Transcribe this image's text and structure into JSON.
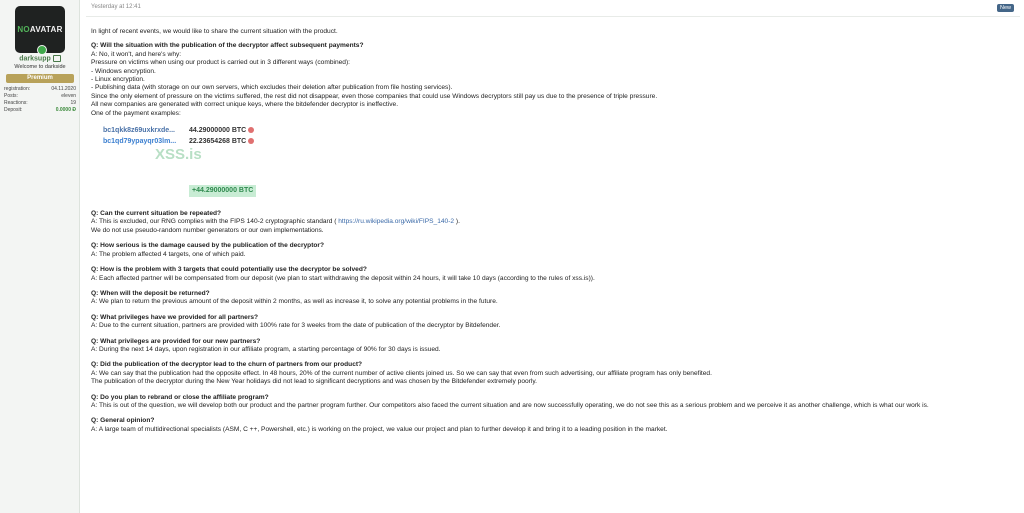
{
  "user": {
    "avatar_text_1": "NO",
    "avatar_text_2": "AVATAR",
    "username": "darksupp",
    "title": "Welcome to darkside",
    "banner": "Premium",
    "stats": [
      {
        "label": "registration:",
        "value": "04.11.2020"
      },
      {
        "label": "Posts:",
        "value": "eleven"
      },
      {
        "label": "Reactions:",
        "value": "19"
      },
      {
        "label": "Deposit:",
        "value": "0.0000 Ð"
      }
    ]
  },
  "post": {
    "timestamp": "Yesterday at 12:41",
    "badge": "New",
    "intro": "In light of recent events, we would like to share the current situation with the product.",
    "q1": {
      "q": "Q: Will the situation with the publication of the decryptor affect subsequent payments?",
      "lines": [
        "A: No, it won't, and here's why:",
        "Pressure on victims when using our product is carried out in 3 different ways (combined):",
        "- Windows encryption.",
        "- Linux encryption.",
        "- Publishing data (with storage on our own servers, which excludes their deletion after publication from file hosting services).",
        "Since the only element of pressure on the victims suffered, the rest did not disappear, even those companies that could use Windows decryptors still pay us due to the presence of triple pressure.",
        "All new companies are generated with correct unique keys, where the bitdefender decryptor is ineffective.",
        "One of the payment examples:"
      ]
    },
    "wallets": [
      {
        "address": "bc1qkk8z69uxkrxde...",
        "amount": "44.29000000 BTC"
      },
      {
        "address": "bc1qd79ypayqr03lm...",
        "amount": "22.23654268 BTC"
      }
    ],
    "watermark": "XSS.is",
    "total": "+44.29000000 BTC",
    "q2": {
      "q": "Q: Can the current situation be repeated?",
      "a_pre": "A: This is excluded, our RNG complies with the FIPS 140-2 cryptographic standard ( ",
      "a_link": "https://ru.wikipedia.org/wiki/FIPS_140-2",
      "a_post": " ).",
      "line2": "We do not use pseudo-random number generators or our own implementations."
    },
    "qa": [
      {
        "q": "Q: How serious is the damage caused by the publication of the decryptor?",
        "a": [
          "A: The problem affected 4 targets, one of which paid."
        ]
      },
      {
        "q": "Q: How is the problem with 3 targets that could potentially use the decryptor be solved?",
        "a": [
          "A: Each affected partner will be compensated from our deposit (we plan to start withdrawing the deposit within 24 hours, it will take 10 days (according to the rules of xss.is))."
        ]
      },
      {
        "q": "Q: When will the deposit be returned?",
        "a": [
          "A: We plan to return the previous amount of the deposit within 2 months, as well as increase it, to solve any potential problems in the future."
        ]
      },
      {
        "q": "Q: What privileges have we provided for all partners?",
        "a": [
          "A: Due to the current situation, partners are provided with 100% rate for 3 weeks from the date of publication of the decryptor by Bitdefender."
        ]
      },
      {
        "q": "Q: What privileges are provided for our new partners?",
        "a": [
          "A: During the next 14 days, upon registration in our affiliate program, a starting percentage of 90% for 30 days is issued."
        ]
      },
      {
        "q": "Q: Did the publication of the decryptor lead to the churn of partners from our product?",
        "a": [
          "A: We can say that the publication had the opposite effect. In 48 hours, 20% of the current number of active clients joined us. So we can say that even from such advertising, our affiliate program has only benefited.",
          "The publication of the decryptor during the New Year holidays did not lead to significant decryptions and was chosen by the Bitdefender extremely poorly."
        ]
      },
      {
        "q": "Q: Do you plan to rebrand or close the affiliate program?",
        "a": [
          "A: This is out of the question, we will develop both our product and the partner program further. Our competitors also faced the current situation and are now successfully operating, we do not see this as a serious problem and we perceive it as another challenge, which is what our work is."
        ]
      },
      {
        "q": "Q: General opinion?",
        "a": [
          "A: A large team of multidirectional specialists (ASM, C ++, Powershell, etc.) is working on the project, we value our project and plan to further develop it and bring it to a leading position in the market."
        ]
      }
    ]
  }
}
